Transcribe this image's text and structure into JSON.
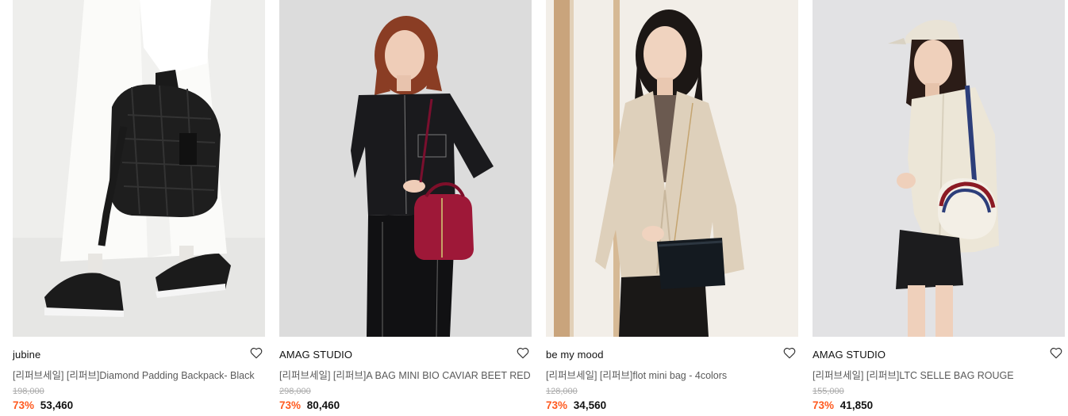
{
  "products": [
    {
      "brand": "jubine",
      "name": "[리퍼브세일] [리퍼브]Diamond Padding Backpack- Black",
      "original_price": "198,000",
      "discount": "73%",
      "price": "53,460",
      "image_icon": "product-photo-backpack"
    },
    {
      "brand": "AMAG STUDIO",
      "name": "[리퍼브세일] [리퍼브]A BAG MINI BIO CAVIAR BEET RED",
      "original_price": "298,000",
      "discount": "73%",
      "price": "80,460",
      "image_icon": "product-photo-red-bag"
    },
    {
      "brand": "be my mood",
      "name": "[리퍼브세일] [리퍼브]flot mini bag - 4colors",
      "original_price": "128,000",
      "discount": "73%",
      "price": "34,560",
      "image_icon": "product-photo-black-crossbody"
    },
    {
      "brand": "AMAG STUDIO",
      "name": "[리퍼브세일] [리퍼브]LTC SELLE BAG ROUGE",
      "original_price": "155,000",
      "discount": "73%",
      "price": "41,850",
      "image_icon": "product-photo-saddle-bag"
    }
  ],
  "colors": {
    "discount": "#ff5a1f",
    "price": "#111111",
    "original_price": "#aaaaaa",
    "name": "#5a5a5a"
  },
  "icons": {
    "wishlist": "heart-outline-icon"
  }
}
